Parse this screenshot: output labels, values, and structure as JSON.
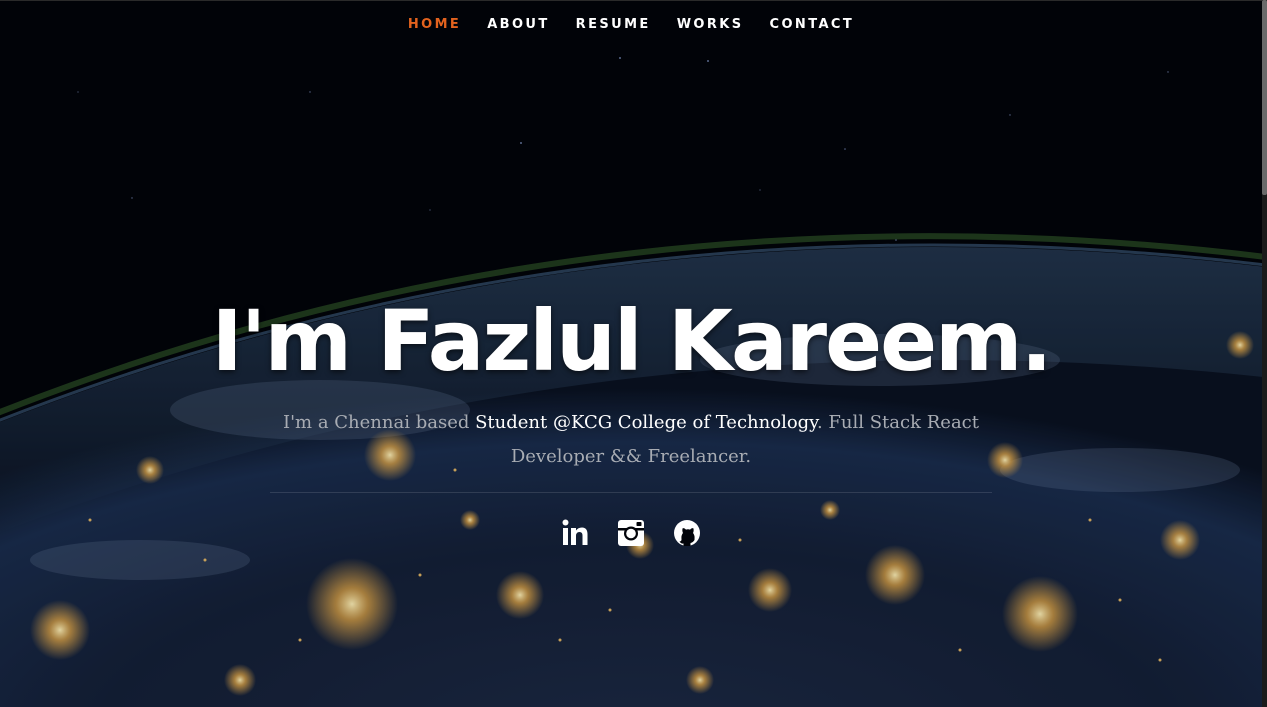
{
  "nav": {
    "items": [
      {
        "label": "HOME",
        "active": true
      },
      {
        "label": "ABOUT",
        "active": false
      },
      {
        "label": "RESUME",
        "active": false
      },
      {
        "label": "WORKS",
        "active": false
      },
      {
        "label": "CONTACT",
        "active": false
      }
    ]
  },
  "hero": {
    "headline": "I'm Fazlul Kareem.",
    "intro_before": "I'm a Chennai based ",
    "intro_highlight": "Student @KCG College of Technology",
    "intro_after": ". Full Stack React Developer && Freelancer.",
    "background": "night view of Earth with city lights from space"
  },
  "social": [
    {
      "name": "LinkedIn",
      "icon": "linkedin-icon"
    },
    {
      "name": "Instagram",
      "icon": "instagram-icon"
    },
    {
      "name": "GitHub",
      "icon": "github-icon"
    }
  ],
  "colors": {
    "accent": "#e2621e",
    "text": "#ffffff",
    "muted": "#a8acb3",
    "background": "#02040a"
  }
}
